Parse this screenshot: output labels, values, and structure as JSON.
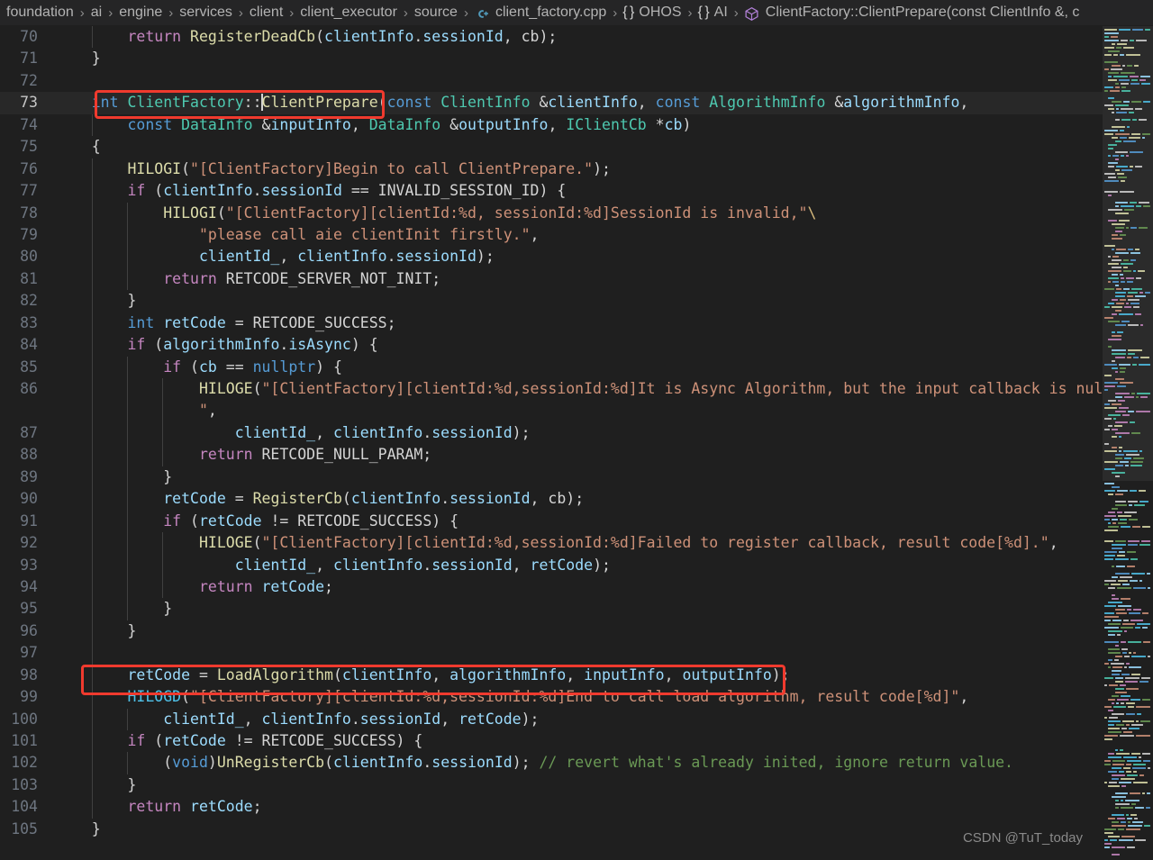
{
  "breadcrumb": {
    "separator": "›",
    "items": [
      {
        "label": "foundation",
        "icon": null
      },
      {
        "label": "ai",
        "icon": null
      },
      {
        "label": "engine",
        "icon": null
      },
      {
        "label": "services",
        "icon": null
      },
      {
        "label": "client",
        "icon": null
      },
      {
        "label": "client_executor",
        "icon": null
      },
      {
        "label": "source",
        "icon": null
      },
      {
        "label": "client_factory.cpp",
        "icon": "cpp-file-icon"
      },
      {
        "label": "OHOS",
        "icon": "namespace-braces-icon"
      },
      {
        "label": "AI",
        "icon": "namespace-braces-icon"
      },
      {
        "label": "ClientFactory::ClientPrepare(const ClientInfo &, c",
        "icon": "method-cube-icon"
      }
    ]
  },
  "editor": {
    "current_line": 73,
    "first_visible_line": 70,
    "last_visible_line": 105,
    "language": "cpp",
    "theme": "Dark+ (default dark)",
    "colors": {
      "background": "#1f1f1f",
      "breadcrumb_background": "#252526",
      "current_line_background": "#282828",
      "line_number": "#6e7681",
      "active_line_number": "#c6c6c6",
      "keyword": "#c586c0",
      "type": "#569cd6",
      "class": "#4ec9b0",
      "function": "#dcdcaa",
      "variable": "#9cdcfe",
      "string": "#ce9178",
      "comment": "#6a9955",
      "macro": "#4fc1e8",
      "annotation_red": "#f03a2e"
    },
    "lines": [
      {
        "n": 70,
        "text": "        return RegisterDeadCb(clientInfo.sessionId, cb);"
      },
      {
        "n": 71,
        "text": "    }"
      },
      {
        "n": 72,
        "text": ""
      },
      {
        "n": 73,
        "text": "    int ClientFactory::ClientPrepare(const ClientInfo &clientInfo, const AlgorithmInfo &algorithmInfo,"
      },
      {
        "n": 74,
        "text": "        const DataInfo &inputInfo, DataInfo &outputInfo, IClientCb *cb)"
      },
      {
        "n": 75,
        "text": "    {"
      },
      {
        "n": 76,
        "text": "        HILOGI(\"[ClientFactory]Begin to call ClientPrepare.\");"
      },
      {
        "n": 77,
        "text": "        if (clientInfo.sessionId == INVALID_SESSION_ID) {"
      },
      {
        "n": 78,
        "text": "            HILOGI(\"[ClientFactory][clientId:%d, sessionId:%d]SessionId is invalid,\"\\"
      },
      {
        "n": 79,
        "text": "                \"please call aie clientInit firstly.\","
      },
      {
        "n": 80,
        "text": "                clientId_, clientInfo.sessionId);"
      },
      {
        "n": 81,
        "text": "            return RETCODE_SERVER_NOT_INIT;"
      },
      {
        "n": 82,
        "text": "        }"
      },
      {
        "n": 83,
        "text": "        int retCode = RETCODE_SUCCESS;"
      },
      {
        "n": 84,
        "text": "        if (algorithmInfo.isAsync) {"
      },
      {
        "n": 85,
        "text": "            if (cb == nullptr) {"
      },
      {
        "n": 86,
        "text": "                HILOGE(\"[ClientFactory][clientId:%d,sessionId:%d]It is Async Algorithm, but the input callback is null.\","
      },
      {
        "n": 87,
        "text": "                    clientId_, clientInfo.sessionId);"
      },
      {
        "n": 88,
        "text": "                return RETCODE_NULL_PARAM;"
      },
      {
        "n": 89,
        "text": "            }"
      },
      {
        "n": 90,
        "text": "            retCode = RegisterCb(clientInfo.sessionId, cb);"
      },
      {
        "n": 91,
        "text": "            if (retCode != RETCODE_SUCCESS) {"
      },
      {
        "n": 92,
        "text": "                HILOGE(\"[ClientFactory][clientId:%d,sessionId:%d]Failed to register callback, result code[%d].\","
      },
      {
        "n": 93,
        "text": "                    clientId_, clientInfo.sessionId, retCode);"
      },
      {
        "n": 94,
        "text": "                return retCode;"
      },
      {
        "n": 95,
        "text": "            }"
      },
      {
        "n": 96,
        "text": "        }"
      },
      {
        "n": 97,
        "text": ""
      },
      {
        "n": 98,
        "text": "        retCode = LoadAlgorithm(clientInfo, algorithmInfo, inputInfo, outputInfo);"
      },
      {
        "n": 99,
        "text": "        HILOGD(\"[ClientFactory][clientId:%d,sessionId:%d]End to call load algorithm, result code[%d]\","
      },
      {
        "n": 100,
        "text": "            clientId_, clientInfo.sessionId, retCode);"
      },
      {
        "n": 101,
        "text": "        if (retCode != RETCODE_SUCCESS) {"
      },
      {
        "n": 102,
        "text": "            (void)UnRegisterCb(clientInfo.sessionId); // revert what's already inited, ignore return value."
      },
      {
        "n": 103,
        "text": "        }"
      },
      {
        "n": 104,
        "text": "        return retCode;"
      },
      {
        "n": 105,
        "text": "    }"
      }
    ],
    "annotations": [
      {
        "name": "highlight-clientprepare-signature",
        "target_line": 73,
        "text": "ClientFactory::ClientPrepare("
      },
      {
        "name": "highlight-loadalgorithm-call",
        "target_line": 98,
        "text": "retCode = LoadAlgorithm(clientInfo, algorithmInfo, inputInfo, outputInfo);"
      }
    ]
  },
  "watermark": {
    "text": "CSDN @TuT_today"
  }
}
